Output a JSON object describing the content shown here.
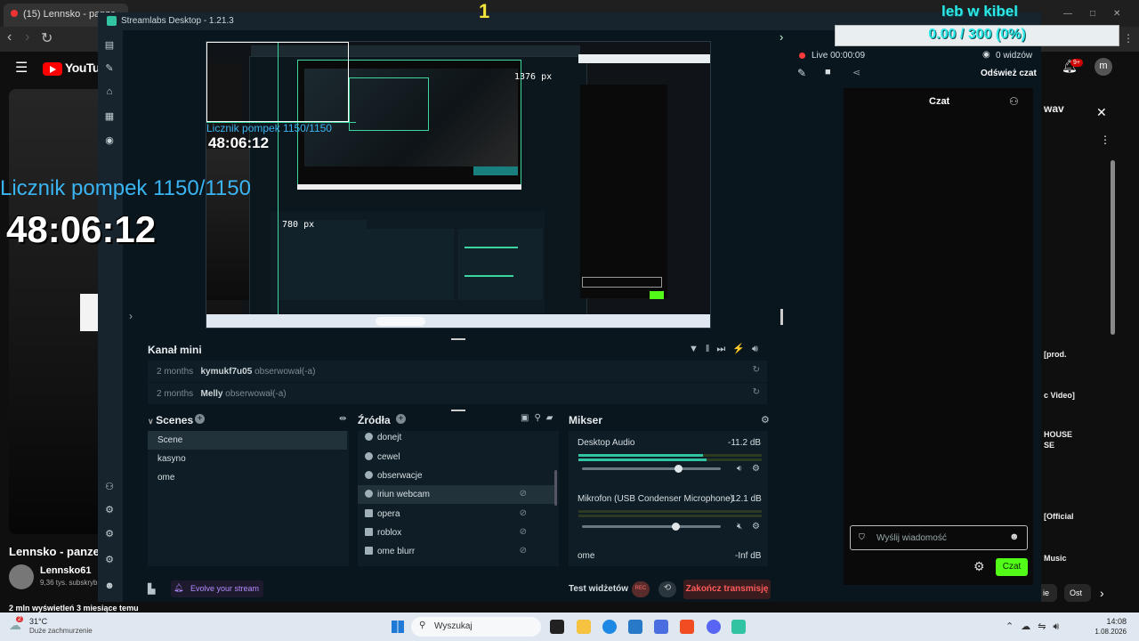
{
  "browser": {
    "tab_title": "(15) Lennsko - panze",
    "nav": {
      "back": "‹",
      "forward": "›",
      "reload": "↻"
    }
  },
  "youtube": {
    "logo": "YouTube",
    "video_title": "Lennsko - panze",
    "channel": "Lennsko61",
    "subs": "9,36 tys. subskryb",
    "views": "2 mln wyświetleń  3 miesiące temu",
    "notif_count": "9+",
    "avatar_letter": "m",
    "side_texts": [
      "wav",
      "[prod.",
      "c Video]",
      "HOUSE",
      "SE",
      "[Official",
      "Music",
      "Ost"
    ],
    "side_chip": "ie"
  },
  "overlays": {
    "counter": "Licznik pompek 1150/1150",
    "timer": "48:06:12",
    "one": "1",
    "goal_title": "leb w kibel",
    "goal_text": "0.00 / 300 (0%)"
  },
  "streamlabs": {
    "title": "Streamlabs Desktop - 1.21.3",
    "live_label": "Live 00:00:09",
    "viewers": "0 widzów",
    "refresh_chat": "Odśwież czat",
    "chat_title": "Czat",
    "chat_placeholder": "Wyślij wiadomość",
    "chat_send": "Czat",
    "nested": {
      "px1": "1376 px",
      "px2": "780 px"
    },
    "mini_feed": {
      "title": "Kanał mini",
      "events": [
        {
          "time": "2 months",
          "user": "kymukf7u05",
          "action": "obserwował(-a)"
        },
        {
          "time": "2 months",
          "user": "Melly",
          "action": "obserwował(-a)"
        }
      ]
    },
    "scenes": {
      "title": "Scenes",
      "items": [
        "Scene",
        "kasyno",
        "ome"
      ]
    },
    "sources": {
      "title": "Źródła",
      "items": [
        "donejt",
        "cewel",
        "obserwacje",
        "iriun webcam",
        "opera",
        "roblox",
        "ome blurr"
      ]
    },
    "mixer": {
      "title": "Mikser",
      "channels": [
        {
          "name": "Desktop Audio",
          "db": "-11.2 dB",
          "level": 0.82
        },
        {
          "name": "Mikrofon (USB Condenser Microphone)",
          "db": "-12.1 dB",
          "level": 0.8
        },
        {
          "name": "ome",
          "db": "-Inf dB",
          "level": 0.0
        }
      ]
    },
    "footer": {
      "evolve": "Evolve your stream",
      "test_widgets": "Test widżetów",
      "end_stream": "Zakończ transmisję"
    }
  },
  "taskbar": {
    "weather_temp": "31°C",
    "weather_desc": "Duże zachmurzenie",
    "weather_badge": "2",
    "search": "Wyszukaj",
    "time": "14:08",
    "date": "1.08.2026"
  },
  "colors": {
    "accent_green": "#53fc18",
    "cyan": "#2de8e8",
    "end_red": "#ff5a5a"
  }
}
